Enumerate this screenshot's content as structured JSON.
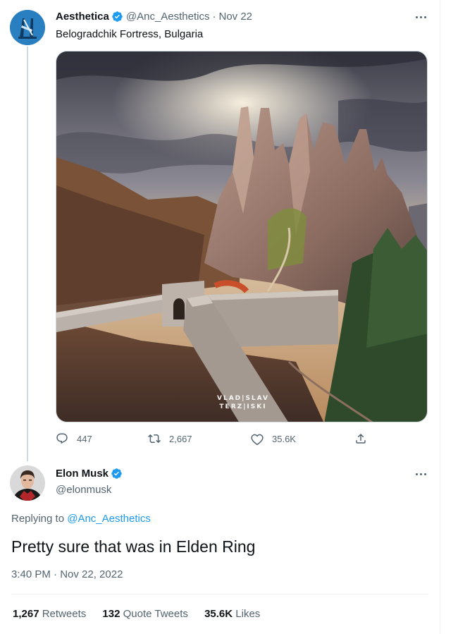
{
  "tweet": {
    "author_name": "Aesthetica",
    "handle": "@Anc_Aesthetics",
    "separator": "·",
    "date": "Nov 22",
    "text": "Belogradchik Fortress, Bulgaria",
    "image_watermark_line1": "VLAD|SLAV",
    "image_watermark_line2": "TERZ|ISKI",
    "actions": {
      "replies": "447",
      "retweets": "2,667",
      "likes": "35.6K"
    }
  },
  "reply": {
    "author_name": "Elon Musk",
    "handle": "@elonmusk",
    "replying_prefix": "Replying to",
    "replying_handle": "@Anc_Aesthetics",
    "text": "Pretty sure that was in Elden Ring",
    "timestamp": "3:40 PM · Nov 22, 2022",
    "stats": {
      "retweets_count": "1,267",
      "retweets_label": "Retweets",
      "quotes_count": "132",
      "quotes_label": "Quote Tweets",
      "likes_count": "35.6K",
      "likes_label": "Likes"
    }
  },
  "colors": {
    "accent": "#1d9bf0",
    "secondary_text": "#536471",
    "primary_text": "#0f1419",
    "divider": "#eff3f4"
  },
  "icons": [
    "verified-badge-icon",
    "more-icon",
    "reply-icon",
    "retweet-icon",
    "like-icon",
    "share-icon"
  ]
}
